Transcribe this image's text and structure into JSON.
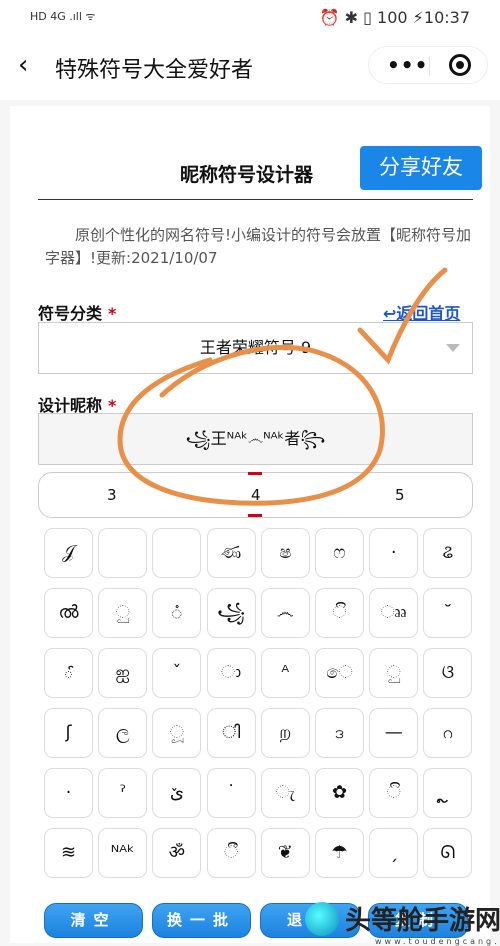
{
  "status_bar": {
    "left": "HD 4G .ıll ᯤ",
    "right": "⏰ ✱ ▯ 100 ⚡10:37",
    "time": "10:37"
  },
  "nav": {
    "back_icon": "chevron-left",
    "title": "特殊符号大全爱好者",
    "more_icon": "•••",
    "target_icon": "record-circle"
  },
  "page": {
    "heading": "昵称符号设计器",
    "share_label": "分享好友",
    "description": "原创个性化的网名符号!小编设计的符号会放置【昵称符号加字器】!更新:2021/10/07"
  },
  "form": {
    "category_label": "符号分类",
    "required": "*",
    "home_link": "↩返回首页",
    "category_value": "王者荣耀符号 9",
    "nickname_label": "设计昵称",
    "nickname_value": "꧁王ᴺᴬᵏ෴ᴺᴬᵏ者꧂",
    "picker": [
      "3",
      "4",
      "5"
    ]
  },
  "symbols": [
    "𝒥",
    "",
    "",
    "ණ",
    "ෂ",
    "ෆ",
    "·",
    "ଌ",
    "ൽ",
    "ු",
    "ံ",
    "꧁",
    "෴",
    "ි",
    "ෲ",
    "˘",
    "ౕ",
    "ஐ",
    "ˇ",
    "ා",
    "ᴬ",
    "ෙ",
    "ු",
    "ଓ",
    "ʃ",
    "ල",
    "ූ",
    "ി",
    "ற",
    "ဒ",
    "—",
    "ဂ",
    "·",
    "ˀ",
    "ێ",
    "˙",
    "ැ",
    "✿",
    "ි",
    "ຼ",
    "≋",
    "ᴺᴬᵏ",
    "ॐ",
    "ී",
    "❦",
    "☂",
    "ˏ",
    "ᘏ"
  ],
  "actions": {
    "clear": "清空",
    "refresh": "换一批",
    "backspace": "退格",
    "copy": "复制"
  },
  "watermark": {
    "text": "头等舱手游网",
    "url": "www.toudengcang.net"
  },
  "colors": {
    "accent": "#1a87e8",
    "required": "#d0021b",
    "annotation": "#e8904a",
    "link": "#1a56c8"
  }
}
